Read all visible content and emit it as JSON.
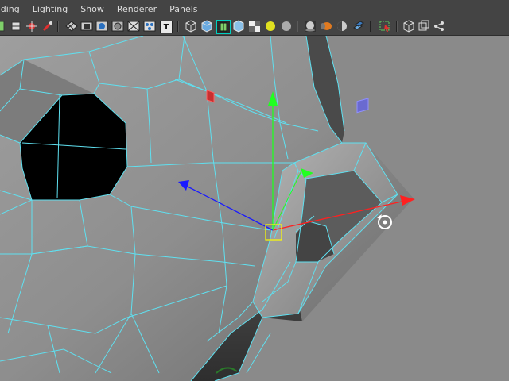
{
  "menu": {
    "items": [
      "ading",
      "Lighting",
      "Show",
      "Renderer",
      "Panels"
    ]
  },
  "toolbar": {
    "icons": [
      "select-camera-icon",
      "light-icon",
      "bookmark-icon",
      "camera-attrs-icon",
      "grid-icon",
      "film-gate-icon",
      "resolution-gate-icon",
      "gate-mask-icon",
      "field-chart-icon",
      "safe-action-icon",
      "text-icon",
      "wireframe-icon",
      "smooth-shade-icon",
      "wireframe-on-shaded-icon",
      "textured-icon",
      "use-lights-icon",
      "default-light-icon",
      "shadows-icon",
      "high-quality-icon",
      "ambient-occlusion-icon",
      "motion-blur-icon",
      "isolate-select-icon",
      "xray-icon",
      "xray-joints-icon",
      "xray-components-icon"
    ],
    "text_icon_label": "T"
  },
  "colors": {
    "panel_bg": "#444444",
    "viewport_bg": "#8a8a8a",
    "wireframe": "#5fe0f0",
    "mesh_light": "#9a9a9a",
    "mesh_dark": "#5a5a5a",
    "eye_socket": "#000000",
    "axis_x": "#ff2020",
    "axis_y": "#20ff20",
    "axis_z": "#1a1aff",
    "pivot": "#ffff00"
  }
}
